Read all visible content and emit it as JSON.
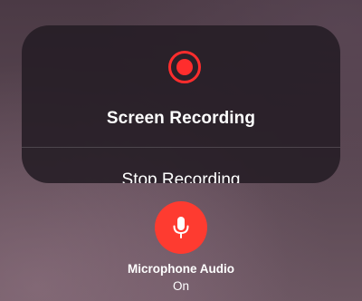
{
  "screen_recording": {
    "title": "Screen Recording",
    "stop_label": "Stop Recording",
    "record_icon": "record-icon",
    "accent_color": "#ff2d2d"
  },
  "microphone": {
    "label": "Microphone Audio",
    "status": "On",
    "icon": "microphone-icon",
    "button_color": "#fe3b30"
  }
}
